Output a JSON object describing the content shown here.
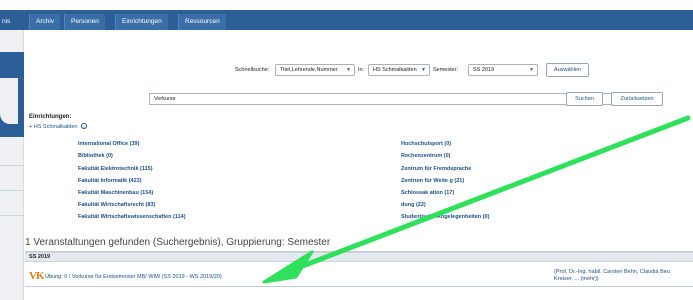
{
  "nav": {
    "tabs": [
      {
        "label": "nis"
      },
      {
        "label": "Archiv"
      },
      {
        "label": "Personen"
      },
      {
        "label": "Einrichtungen"
      },
      {
        "label": "Ressourcen"
      }
    ]
  },
  "search": {
    "quick_label": "Schnellsuche:",
    "quick_value": "Titel,Lehrende,Nummer",
    "in_label": "In:",
    "in_value": "HS Schmalkalden",
    "semester_label": "Semester:",
    "semester_value": "SS 2019",
    "select_button": "Auswählen",
    "query": "Vorkurse",
    "search_button": "Suchen",
    "reset_button": "Zurücksetzen"
  },
  "institutions": {
    "title": "Einrichtungen:",
    "root": "+ HS Schmalkalden",
    "info_icon": "info-circle-icon",
    "left": [
      "International Office (39)",
      "Bibliothek (0)",
      "Fakultät Elektrotechnik (115)",
      "Fakultät Informatik (423)",
      "Fakultät Maschinenbau (154)",
      "Fakultät Wirtschaftsrecht (83)",
      "Fakultät Wirtschaftswissenschaften (114)"
    ],
    "right": [
      "Hochschulsport (0)",
      "Rechenzentrum (0)",
      "Zentrum für Fremdsprache",
      "Zentrum für Weite        g (21)",
      "Schlossak        ation (17)",
      "        dung (22)",
      "Studentische Angelegenheiten (0)"
    ]
  },
  "results": {
    "header": "1 Veranstaltungen gefunden (Suchergebnis), Gruppierung: Semester",
    "group": "SS 2019",
    "item": {
      "icon": "VK",
      "title": "Übung: 0 / Vorkurse für Erstsemester MB/ WIW (SS 2019 - WS 2019/20)",
      "lecturers_line1": "(Prof. Dr.-Ing. habil. Carsten Behn, Claudia Beu",
      "lecturers_line2": "Kretzer, ... (mehr))"
    }
  },
  "colors": {
    "nav": "#2c5f98",
    "link": "#1d4f8a",
    "annotation_arrow": "#2ee05a",
    "vk_icon": "#e07a10"
  }
}
